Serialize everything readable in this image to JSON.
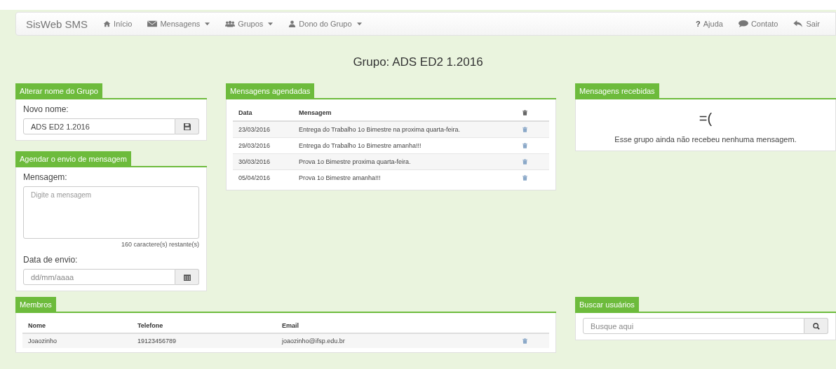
{
  "navbar": {
    "brand": "SisWeb SMS",
    "left": [
      {
        "label": "Início",
        "dropdown": false
      },
      {
        "label": "Mensagens",
        "dropdown": true
      },
      {
        "label": "Grupos",
        "dropdown": true
      },
      {
        "label": "Dono do Grupo",
        "dropdown": true
      }
    ],
    "right": [
      {
        "label": "Ajuda",
        "glyph": "?"
      },
      {
        "label": "Contato"
      },
      {
        "label": "Sair"
      }
    ]
  },
  "page_title": "Grupo: ADS ED2 1.2016",
  "rename_panel": {
    "title": "Alterar nome do Grupo",
    "label": "Novo nome:",
    "value": "ADS ED2 1.2016"
  },
  "schedule_panel": {
    "title": "Agendar o envio de mensagem",
    "message_label": "Mensagem:",
    "message_placeholder": "Digite a mensagem",
    "counter": "160 caractere(s) restante(s)",
    "date_label": "Data de envio:",
    "date_placeholder": "dd/mm/aaaa"
  },
  "scheduled_panel": {
    "title": "Mensagens agendadas",
    "columns": [
      "Data",
      "Mensagem"
    ],
    "rows": [
      {
        "date": "23/03/2016",
        "message": "Entrega do Trabalho 1o Bimestre na proxima quarta-feira."
      },
      {
        "date": "29/03/2016",
        "message": "Entrega do Trabalho 1o Bimestre amanha!!!"
      },
      {
        "date": "30/03/2016",
        "message": "Prova 1o Bimestre proxima quarta-feira."
      },
      {
        "date": "05/04/2016",
        "message": "Prova 1o Bimestre amanha!!!"
      }
    ]
  },
  "received_panel": {
    "title": "Mensagens recebidas",
    "emoticon": "=(",
    "message": "Esse grupo ainda não recebeu nenhuma mensagem."
  },
  "members_panel": {
    "title": "Membros",
    "columns": [
      "Nome",
      "Telefone",
      "Email"
    ],
    "rows": [
      {
        "name": "Joaozinho",
        "phone": "19123456789",
        "email": "joaozinho@ifsp.edu.br"
      }
    ]
  },
  "search_panel": {
    "title": "Buscar usuários",
    "placeholder": "Busque aqui"
  }
}
